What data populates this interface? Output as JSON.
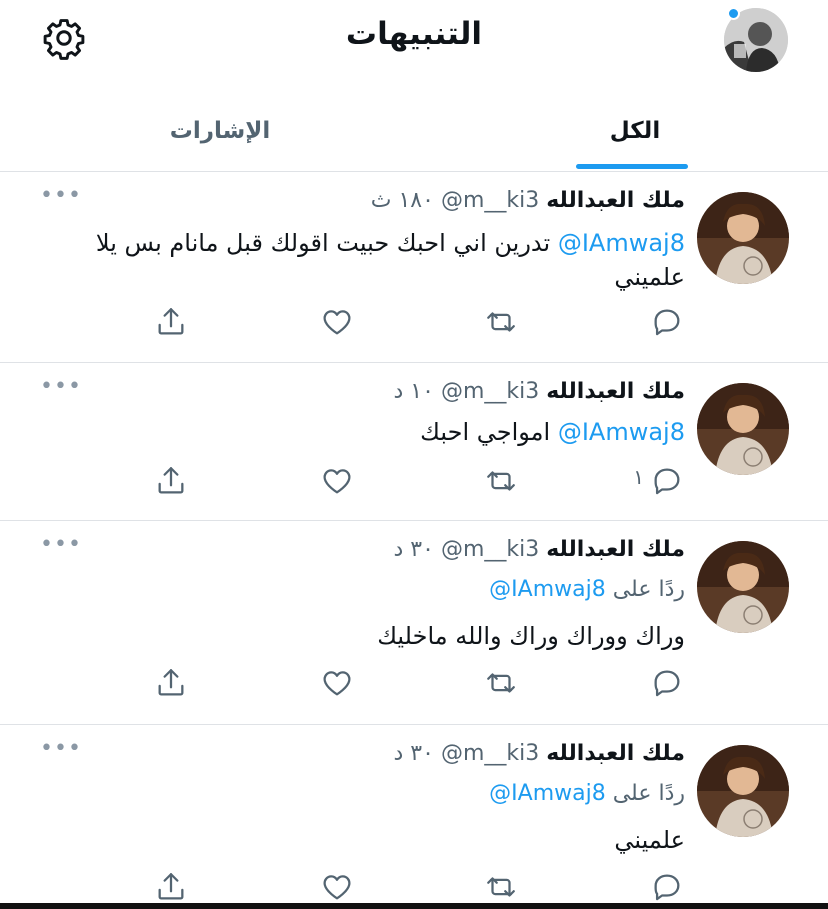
{
  "header": {
    "title": "التنبيهات",
    "settings_icon": "gear-icon",
    "accent_color": "#1d9bf0"
  },
  "tabs": [
    {
      "label": "الكل",
      "active": true
    },
    {
      "label": "الإشارات",
      "active": false
    }
  ],
  "tweets": [
    {
      "author": "ملك العبدالله",
      "handle": "@m__ki3",
      "time": "١٨٠ ث",
      "reply_to": null,
      "mention": "@IAmwaj8",
      "text": "تدرين اني احبك حبيت اقولك قبل مانام بس  يلا علميني",
      "reply_count": ""
    },
    {
      "author": "ملك العبدالله",
      "handle": "@m__ki3",
      "time": "١٠ د",
      "reply_to": null,
      "mention": "@IAmwaj8",
      "text": "امواجي احبك",
      "reply_count": "١"
    },
    {
      "author": "ملك العبدالله",
      "handle": "@m__ki3",
      "time": "٣٠ د",
      "reply_to_label": "ردًا على",
      "reply_to": "@IAmwaj8",
      "text": "وراك ووراك وراك والله ماخليك",
      "reply_count": ""
    },
    {
      "author": "ملك العبدالله",
      "handle": "@m__ki3",
      "time": "٣٠ د",
      "reply_to_label": "ردًا على",
      "reply_to": "@IAmwaj8",
      "text": "علميني",
      "reply_count": ""
    }
  ],
  "more_label": "•••"
}
